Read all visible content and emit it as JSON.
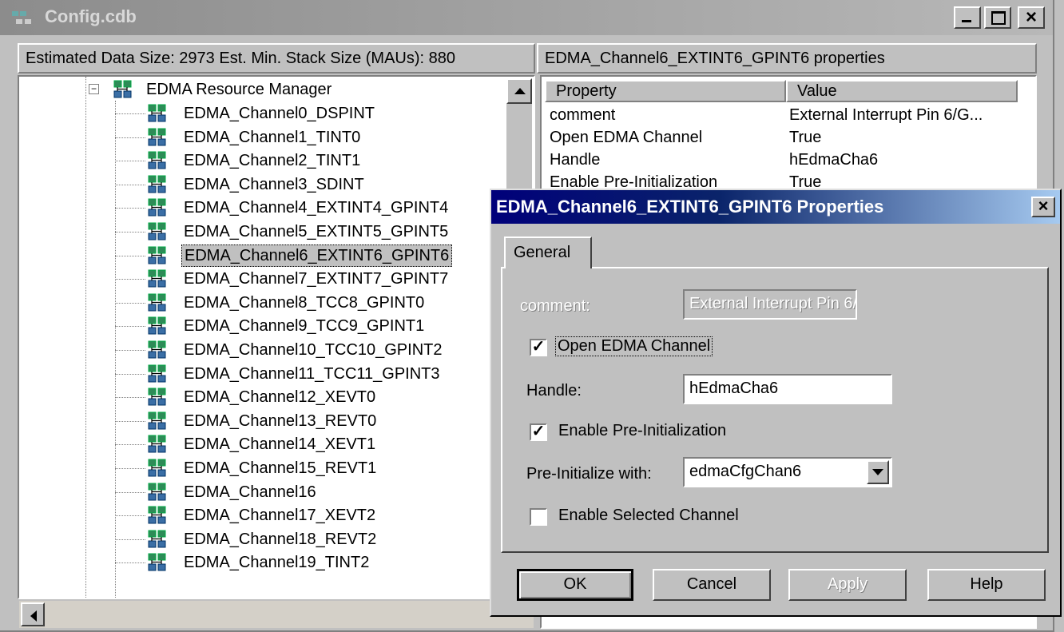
{
  "window": {
    "title": "Config.cdb"
  },
  "left_panel": {
    "header": "Estimated Data Size: 2973   Est. Min. Stack Size (MAUs): 880",
    "tree": {
      "root": {
        "label": "EDMA Resource Manager",
        "expander": "−"
      },
      "items": [
        {
          "label": "EDMA_Channel0_DSPINT"
        },
        {
          "label": "EDMA_Channel1_TINT0"
        },
        {
          "label": "EDMA_Channel2_TINT1"
        },
        {
          "label": "EDMA_Channel3_SDINT"
        },
        {
          "label": "EDMA_Channel4_EXTINT4_GPINT4"
        },
        {
          "label": "EDMA_Channel5_EXTINT5_GPINT5"
        },
        {
          "label": "EDMA_Channel6_EXTINT6_GPINT6",
          "selected": true
        },
        {
          "label": "EDMA_Channel7_EXTINT7_GPINT7"
        },
        {
          "label": "EDMA_Channel8_TCC8_GPINT0"
        },
        {
          "label": "EDMA_Channel9_TCC9_GPINT1"
        },
        {
          "label": "EDMA_Channel10_TCC10_GPINT2"
        },
        {
          "label": "EDMA_Channel11_TCC11_GPINT3"
        },
        {
          "label": "EDMA_Channel12_XEVT0"
        },
        {
          "label": "EDMA_Channel13_REVT0"
        },
        {
          "label": "EDMA_Channel14_XEVT1"
        },
        {
          "label": "EDMA_Channel15_REVT1"
        },
        {
          "label": "EDMA_Channel16"
        },
        {
          "label": "EDMA_Channel17_XEVT2"
        },
        {
          "label": "EDMA_Channel18_REVT2"
        },
        {
          "label": "EDMA_Channel19_TINT2"
        }
      ]
    }
  },
  "right_panel": {
    "header": "EDMA_Channel6_EXTINT6_GPINT6 properties",
    "columns": [
      "Property",
      "Value"
    ],
    "rows": [
      [
        "comment",
        "External Interrupt Pin 6/G..."
      ],
      [
        "Open EDMA Channel",
        "True"
      ],
      [
        "Handle",
        "hEdmaCha6"
      ],
      [
        "Enable Pre-Initialization",
        "True"
      ]
    ]
  },
  "dialog": {
    "title": "EDMA_Channel6_EXTINT6_GPINT6 Properties",
    "close_glyph": "×",
    "tab": "General",
    "comment_label": "comment:",
    "comment_value": "External Interrupt Pin 6/",
    "open_channel": {
      "label": "Open EDMA Channel",
      "checked": true,
      "mark": "✓"
    },
    "handle_label": "Handle:",
    "handle_value": "hEdmaCha6",
    "pre_init": {
      "label": "Enable Pre-Initialization",
      "checked": true,
      "mark": "✓"
    },
    "preinit_with_label": "Pre-Initialize with:",
    "preinit_with_value": "edmaCfgChan6",
    "enable_selected": {
      "label": "Enable Selected Channel",
      "checked": false,
      "mark": ""
    },
    "buttons": {
      "ok": "OK",
      "cancel": "Cancel",
      "apply": "Apply",
      "help": "Help"
    }
  },
  "colors": {
    "dialog_title_start": "#00007a",
    "dialog_title_end": "#a6caf0",
    "face": "#c0c0c0",
    "tree_icon": "#2e8b57"
  },
  "icons": {
    "tree_node": "edma-node-icon",
    "app": "config-app-icon"
  }
}
